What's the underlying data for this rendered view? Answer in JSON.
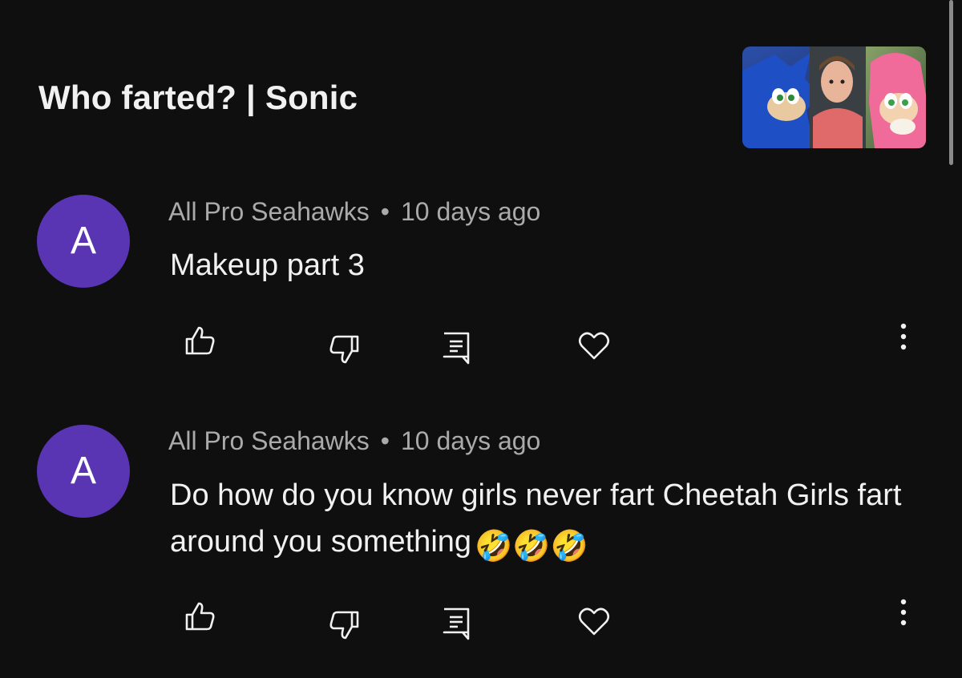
{
  "video": {
    "title": "Who farted? | Sonic",
    "thumbnail_icon": "video-thumbnail"
  },
  "comments": [
    {
      "avatar_letter": "A",
      "author": "All Pro Seahawks",
      "separator": "•",
      "time": "10 days ago",
      "text": "Makeup part 3",
      "emoji": ""
    },
    {
      "avatar_letter": "A",
      "author": "All Pro Seahawks",
      "separator": "•",
      "time": "10 days ago",
      "text": "Do how do you know girls never fart Cheetah Girls fart around you something",
      "emoji": "🤣🤣🤣"
    }
  ],
  "icons": {
    "like": "thumbs-up-icon",
    "dislike": "thumbs-down-icon",
    "reply": "reply-icon",
    "heart": "heart-icon",
    "more": "more-vertical-icon"
  },
  "colors": {
    "background": "#0f0f0f",
    "avatar": "#5a35b3",
    "meta_text": "#aaaaaa",
    "text": "#f1f1f1"
  }
}
